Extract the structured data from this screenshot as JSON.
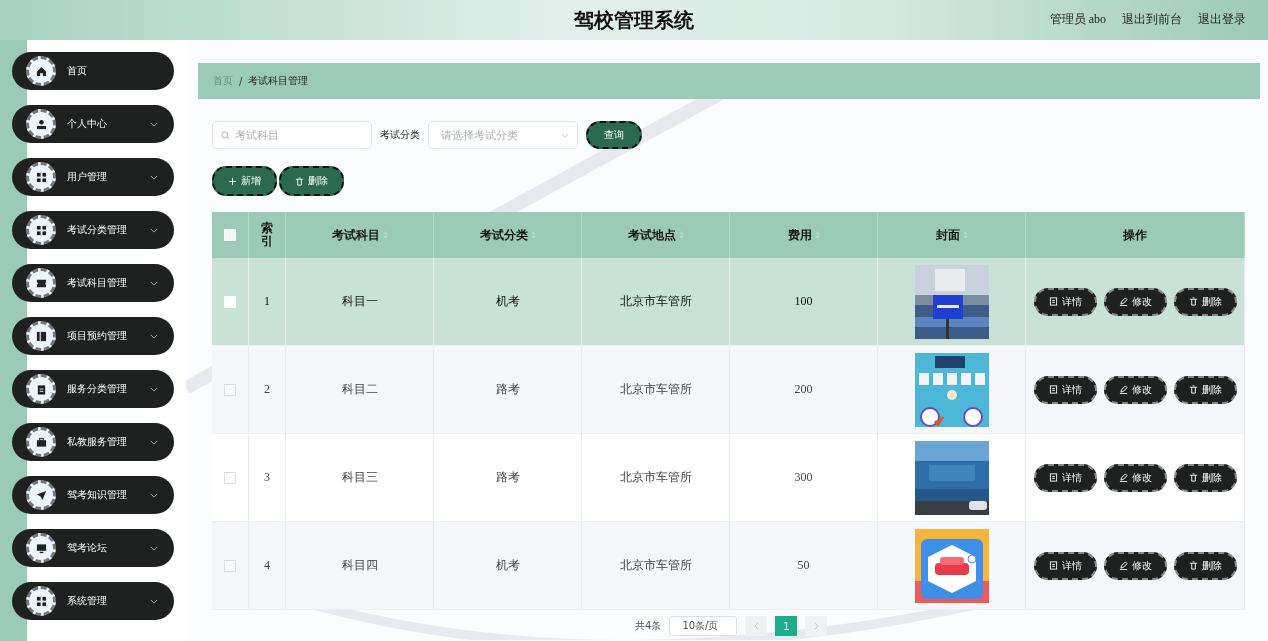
{
  "header": {
    "title": "驾校管理系统",
    "user": "管理员 abo",
    "links": [
      "退出到前台",
      "退出登录"
    ]
  },
  "sidebar": {
    "items": [
      {
        "label": "首页",
        "expandable": false
      },
      {
        "label": "个人中心",
        "expandable": true
      },
      {
        "label": "用户管理",
        "expandable": true
      },
      {
        "label": "考试分类管理",
        "expandable": true
      },
      {
        "label": "考试科目管理",
        "expandable": true
      },
      {
        "label": "项目预约管理",
        "expandable": true
      },
      {
        "label": "服务分类管理",
        "expandable": true
      },
      {
        "label": "私教服务管理",
        "expandable": true
      },
      {
        "label": "驾考知识管理",
        "expandable": true
      },
      {
        "label": "驾考论坛",
        "expandable": true
      },
      {
        "label": "系统管理",
        "expandable": true
      }
    ]
  },
  "breadcrumb": {
    "items": [
      "首页",
      "考试科目管理"
    ],
    "separator": "/"
  },
  "search": {
    "placeholder": "考试科目",
    "category_label": "考试分类",
    "category_placeholder": "请选择考试分类",
    "query_button": "查询"
  },
  "actions": [
    "新增",
    "删除"
  ],
  "table": {
    "select_all": {
      "checked": false
    },
    "columns": [
      {
        "label": "索引",
        "sortable": false
      },
      {
        "label": "考试科目",
        "sortable": true
      },
      {
        "label": "考试分类",
        "sortable": true
      },
      {
        "label": "考试地点",
        "sortable": true
      },
      {
        "label": "费用",
        "sortable": true
      },
      {
        "label": "封面",
        "sortable": true
      },
      {
        "label": "操作",
        "sortable": false
      }
    ],
    "rows": [
      {
        "index": "1",
        "subject": "科目一",
        "category": "机考",
        "place": "北京市车管所",
        "fee": "100",
        "cover": {
          "kind": "picture"
        },
        "actions": [
          "详情",
          "修改",
          "删除"
        ],
        "selected": true
      },
      {
        "index": "2",
        "subject": "科目二",
        "category": "路考",
        "place": "北京市车管所",
        "fee": "200",
        "cover": {
          "kind": "picture"
        },
        "actions": [
          "详情",
          "修改",
          "删除"
        ],
        "selected": false
      },
      {
        "index": "3",
        "subject": "科目三",
        "category": "路考",
        "place": "北京市车管所",
        "fee": "300",
        "cover": {
          "kind": "picture"
        },
        "actions": [
          "详情",
          "修改",
          "删除"
        ],
        "selected": false
      },
      {
        "index": "4",
        "subject": "科目四",
        "category": "机考",
        "place": "北京市车管所",
        "fee": "50",
        "cover": {
          "kind": "picture"
        },
        "actions": [
          "详情",
          "修改",
          "删除"
        ],
        "selected": false
      }
    ]
  },
  "pagination": {
    "total": "共4条",
    "page_size": "10条/页",
    "pages": [
      {
        "label": "1",
        "selected": true
      }
    ]
  }
}
